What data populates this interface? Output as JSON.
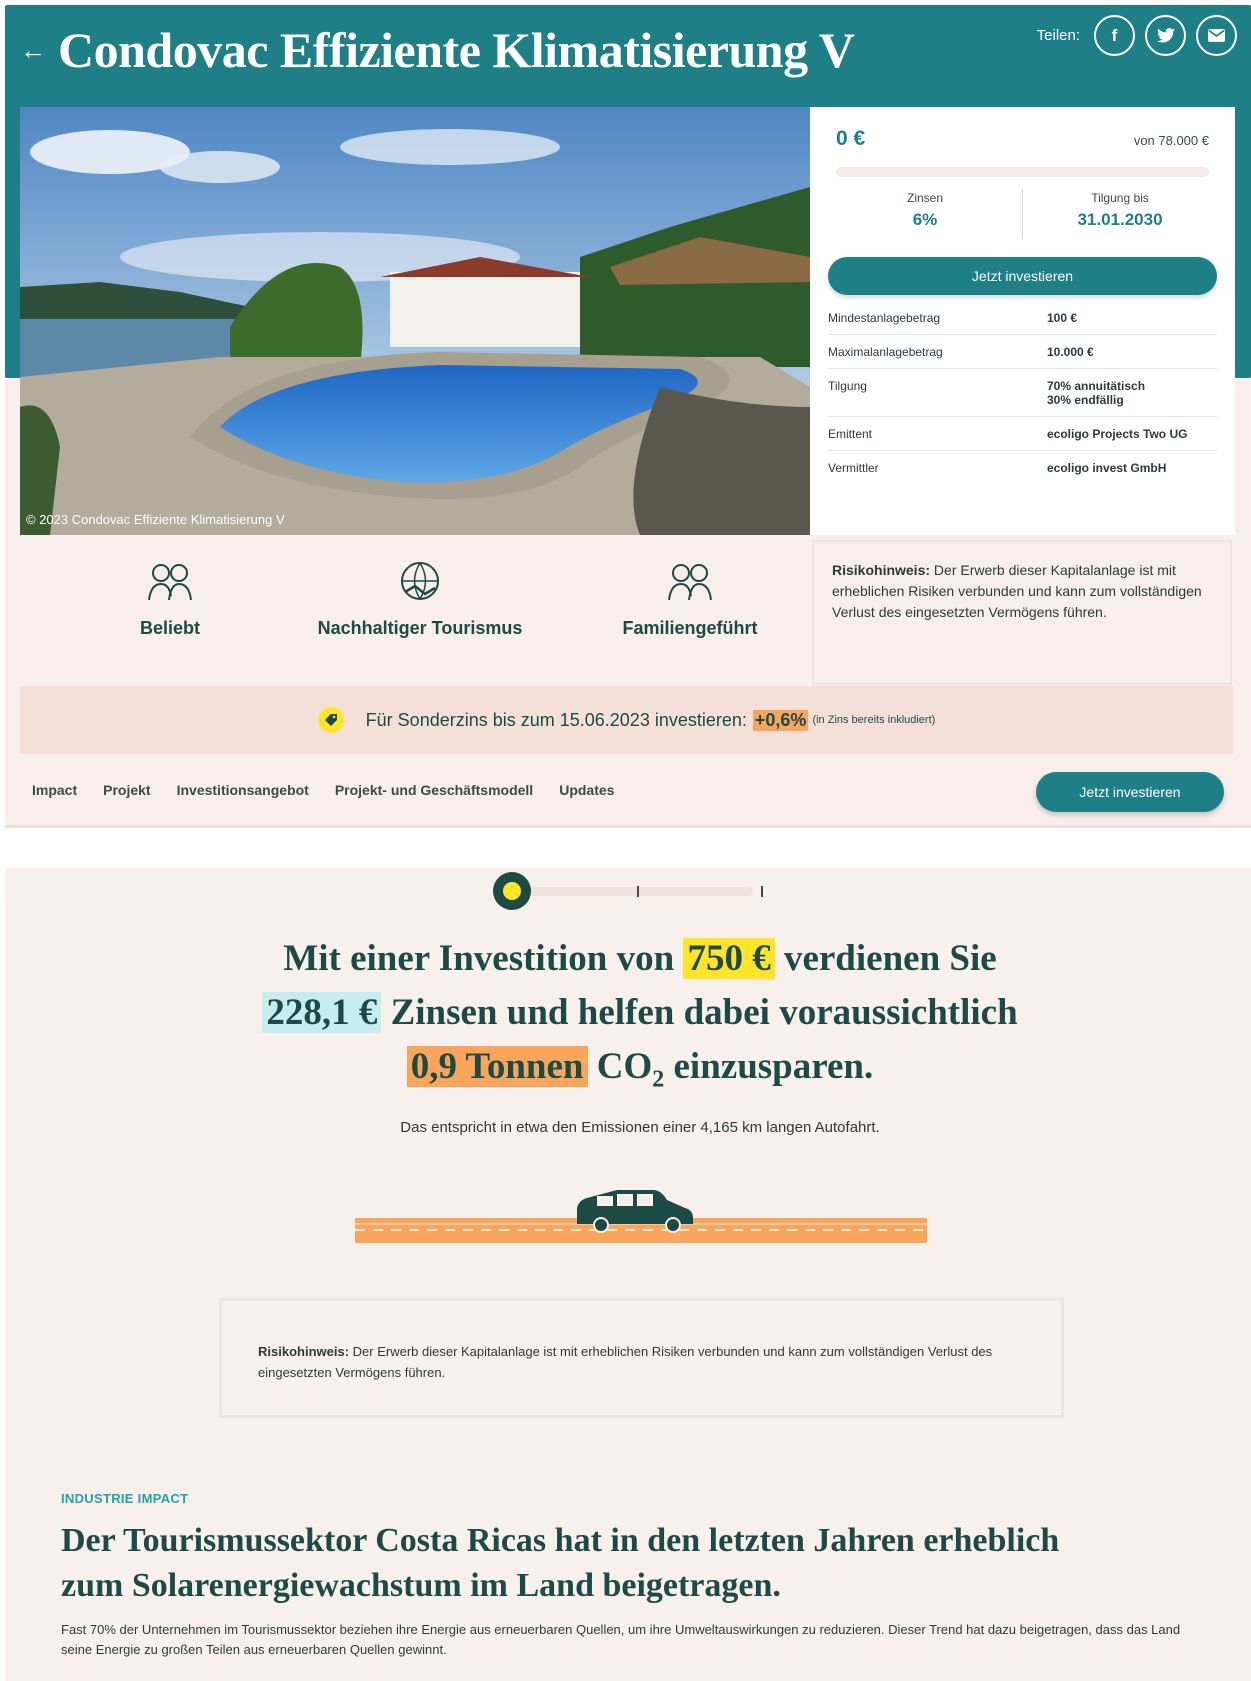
{
  "header": {
    "back_icon": "arrow-left-icon",
    "title": "Condovac Effiziente Klimatisierung V",
    "share_label": "Teilen:",
    "share_buttons": [
      {
        "icon": "facebook-icon",
        "glyph": "f"
      },
      {
        "icon": "twitter-icon",
        "glyph": "🐦"
      },
      {
        "icon": "mail-icon",
        "glyph": "✉"
      }
    ]
  },
  "photo": {
    "caption": "© 2023 Condovac Effiziente Klimatisierung V"
  },
  "card": {
    "amount": "0 €",
    "amount_of": "von 78.000 €",
    "progress_fraction": 0,
    "interest_label": "Zinsen",
    "interest_value": "6%",
    "repayment_label": "Tilgung bis",
    "repayment_value": "31.01.2030",
    "invest_label": "Jetzt investieren",
    "facts": [
      {
        "label": "Mindestanlagebetrag",
        "value": "100 €"
      },
      {
        "label": "Maximalanlagebetrag",
        "value": "10.000 €"
      },
      {
        "label": "Tilgung",
        "value": "70% annuitätisch",
        "value2": "30% endfällig"
      },
      {
        "label": "Emittent",
        "value": "ecoligo Projects Two UG"
      },
      {
        "label": "Vermittler",
        "value": "ecoligo invest GmbH"
      }
    ]
  },
  "features": [
    {
      "icon": "people-icon",
      "label": "Beliebt"
    },
    {
      "icon": "globe-handshake-icon",
      "label": "Nachhaltiger Tourismus"
    },
    {
      "icon": "family-icon",
      "label": "Familiengeführt"
    }
  ],
  "risk_notice": {
    "bold": "Risikohinweis:",
    "text": " Der Erwerb dieser Kapitalanlage ist mit erheblichen Risiken verbunden und kann zum vollständigen Verlust des eingesetzten Vermögens führen."
  },
  "bonus": {
    "icon": "tag-icon",
    "text": "Für Sonderzins bis zum 15.06.2023 investieren:",
    "highlight": "+0,6%",
    "note": "(in Zins bereits inkludiert)"
  },
  "nav": {
    "items": [
      "Impact",
      "Projekt",
      "Investitionsangebot",
      "Projekt- und Geschäftsmodell",
      "Updates"
    ],
    "cta": "Jetzt investieren"
  },
  "impact": {
    "slider_level_index": 0,
    "line1_pre": "Mit einer Investition von",
    "investment": "750 €",
    "line1_post": "verdienen Sie",
    "interest": "228,1 €",
    "line2_post": "Zinsen und helfen dabei voraussichtlich",
    "co2": "0,9 Tonnen",
    "co2_label": "CO",
    "co2_sub": "2",
    "line3_post": "einzusparen.",
    "equivalent": "Das entspricht in etwa den Emissionen einer 4,165 km langen Autofahrt.",
    "car_icon": "car-icon"
  },
  "industry": {
    "eyebrow": "INDUSTRIE IMPACT",
    "title": "Der Tourismussektor Costa Ricas hat in den letzten Jahren erheblich zum Solarenergiewachstum im Land beigetragen.",
    "text": "Fast 70% der Unternehmen im Tourismussektor beziehen ihre Energie aus erneuerbaren Quellen, um ihre Umweltauswirkungen zu reduzieren. Dieser Trend hat dazu beigetragen, dass das Land seine Energie zu großen Teilen aus erneuerbaren Quellen gewinnt."
  },
  "colors": {
    "brand_teal": "#1f7f86",
    "dark_green": "#1d4a45",
    "yellow": "#ffe42c",
    "orange": "#f9a65c",
    "light_blue": "#c6eef0",
    "pink_bg": "#f8eeeb"
  }
}
